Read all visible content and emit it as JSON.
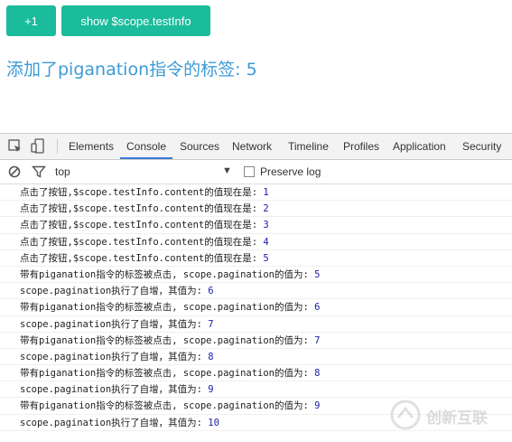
{
  "page": {
    "buttons": {
      "increment_label": "+1",
      "show_label": "show $scope.testInfo"
    },
    "headline": "添加了piganation指令的标签: 5"
  },
  "devtools": {
    "tabs": [
      {
        "label": "Elements",
        "active": false
      },
      {
        "label": "Console",
        "active": true
      },
      {
        "label": "Sources",
        "active": false
      },
      {
        "label": "Network",
        "active": false
      },
      {
        "label": "Timeline",
        "active": false
      },
      {
        "label": "Profiles",
        "active": false
      },
      {
        "label": "Application",
        "active": false
      },
      {
        "label": "Security",
        "active": false
      }
    ],
    "filter": {
      "context": "top",
      "preserve_log_label": "Preserve log",
      "preserve_log_checked": false
    },
    "console_lines": [
      {
        "text": "点击了按钮,$scope.testInfo.content的值现在是: ",
        "value": "1"
      },
      {
        "text": "点击了按钮,$scope.testInfo.content的值现在是: ",
        "value": "2"
      },
      {
        "text": "点击了按钮,$scope.testInfo.content的值现在是: ",
        "value": "3"
      },
      {
        "text": "点击了按钮,$scope.testInfo.content的值现在是: ",
        "value": "4"
      },
      {
        "text": "点击了按钮,$scope.testInfo.content的值现在是: ",
        "value": "5"
      },
      {
        "text": "带有piganation指令的标签被点击, scope.pagination的值为: ",
        "value": "5"
      },
      {
        "text": "scope.pagination执行了自增，其值为: ",
        "value": "6"
      },
      {
        "text": "带有piganation指令的标签被点击, scope.pagination的值为: ",
        "value": "6"
      },
      {
        "text": "scope.pagination执行了自增，其值为: ",
        "value": "7"
      },
      {
        "text": "带有piganation指令的标签被点击, scope.pagination的值为: ",
        "value": "7"
      },
      {
        "text": "scope.pagination执行了自增，其值为: ",
        "value": "8"
      },
      {
        "text": "带有piganation指令的标签被点击, scope.pagination的值为: ",
        "value": "8"
      },
      {
        "text": "scope.pagination执行了自增，其值为: ",
        "value": "9"
      },
      {
        "text": "带有piganation指令的标签被点击, scope.pagination的值为: ",
        "value": "9"
      },
      {
        "text": "scope.pagination执行了自增，其值为: ",
        "value": "10"
      }
    ]
  },
  "watermark": {
    "text": "创新互联"
  },
  "colors": {
    "button": "#1abc9c",
    "headline": "#3c9ad6",
    "active_tab": "#3879d9",
    "console_number": "#1a1aa6"
  }
}
